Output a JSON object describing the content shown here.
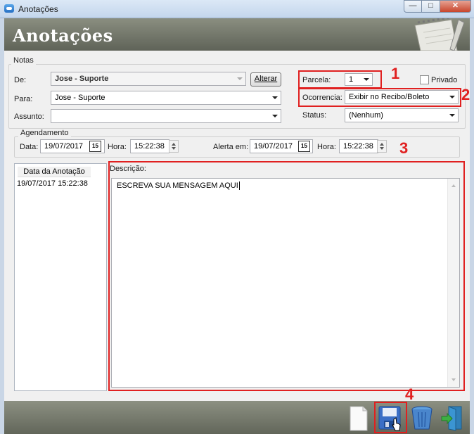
{
  "window": {
    "title": "Anotações",
    "min": "—",
    "max": "□",
    "close": "✕"
  },
  "header": {
    "title": "Anotações"
  },
  "notas": {
    "legend": "Notas",
    "de_label": "De:",
    "de_value": "Jose - Suporte",
    "alterar": "Alterar",
    "para_label": "Para:",
    "para_value": "Jose - Suporte",
    "assunto_label": "Assunto:",
    "assunto_value": "",
    "parcela_label": "Parcela:",
    "parcela_value": "1",
    "privado_label": "Privado",
    "ocorrencia_label": "Ocorrencia:",
    "ocorrencia_value": "Exibir no Recibo/Boleto",
    "status_label": "Status:",
    "status_value": "(Nenhum)"
  },
  "agendamento": {
    "legend": "Agendamento",
    "data_label": "Data:",
    "data_value": "19/07/2017",
    "hora_label": "Hora:",
    "hora_value": "15:22:38",
    "alerta_label": "Alerta em:",
    "alerta_value": "19/07/2017",
    "hora2_label": "Hora:",
    "hora2_value": "15:22:38",
    "calendar_icon_text": "15"
  },
  "list": {
    "header": "Data da Anotação",
    "rows": [
      "19/07/2017 15:22:38"
    ]
  },
  "descricao": {
    "label": "Descrição:",
    "text": "ESCREVA SUA MENSAGEM AQUI"
  },
  "annotations": {
    "n1": "1",
    "n2": "2",
    "n3": "3",
    "n4": "4"
  },
  "footer_icons": [
    "new-document-icon",
    "save-icon",
    "trash-icon",
    "exit-icon"
  ],
  "colors": {
    "annotation_red": "#e02020",
    "header_bg": "#6e7266"
  }
}
